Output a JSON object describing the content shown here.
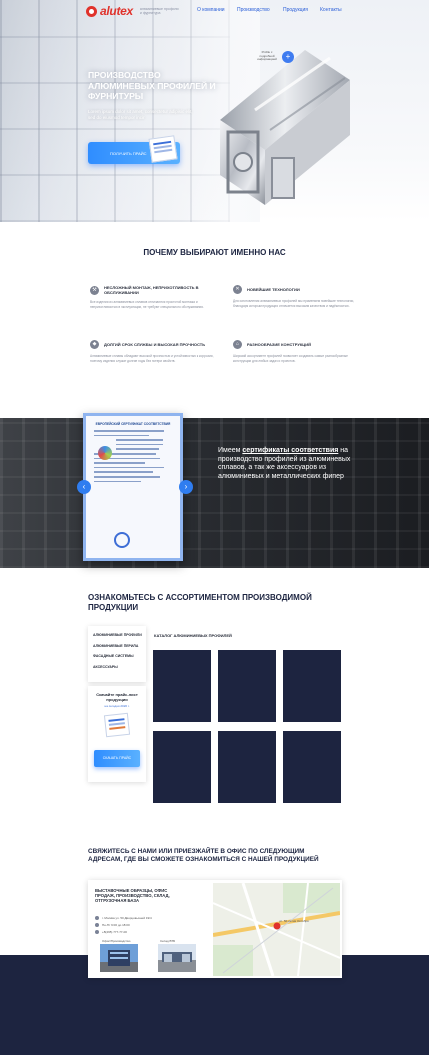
{
  "header": {
    "logo_text": "alutex",
    "logo_tagline": "алюминиевые профили и фурнитура",
    "nav": [
      "О компании",
      "Производство",
      "Продукция",
      "Контакты"
    ]
  },
  "hero": {
    "title": "ПРОИЗВОДСТВО АЛЮМИНЕВЫХ ПРОФИЛЕЙ И ФУРНИТУРЫ",
    "subtitle": "Lorem ipsum dolor sit amet, consectetur adipisic elit, sed do eiusmod tempor incir",
    "cta_label": "ПОЛУЧИТЬ ПРАЙС",
    "pin_label": "Profile с подробной информацией",
    "pin_icon": "plus-icon"
  },
  "why": {
    "title": "ПОЧЕМУ ВЫБИРАЮТ ИМЕННО НАС",
    "features": [
      {
        "icon": "wrench-icon",
        "title": "НЕСЛОЖНЫЙ МОНТАЖ, НЕПРИХОТЛИВОСТЬ В ОБСЛУЖИВАНИИ",
        "text": "Все изделия из алюминиевых сплавов отличаются простотой монтажа и неприхотливостью в эксплуатации, не требуют специального обслуживания."
      },
      {
        "icon": "tech-icon",
        "title": "НОВЕЙШИЕ ТЕХНОЛОГИИ",
        "text": "Для изготовления алюминиевых профилей мы применяем новейшие технологии, благодаря которым продукция отличается высоким качеством и надёжностью."
      },
      {
        "icon": "shield-icon",
        "title": "ДОЛГИЙ СРОК СЛУЖБЫ И ВЫСОКАЯ ПРОЧНОСТЬ",
        "text": "Алюминиевые сплавы обладают высокой прочностью и устойчивостью к коррозии, поэтому изделия служат долгие годы без потери свойств."
      },
      {
        "icon": "house-icon",
        "title": "РАЗНООБРАЗИЕ КОНСТРУКЦИЙ",
        "text": "Широкий ассортимент профилей позволяет создавать самые разнообразные конструкции для любых задач и проектов."
      }
    ]
  },
  "cert": {
    "doc_title": "ЕВРОПЕЙСКИЙ СЕРТИФИКАТ СООТВЕТСТВИЯ",
    "text_prefix": "Имеем",
    "text_highlight": "сертификаты соответствия",
    "text_rest": "на производство профилей из алюминевых сплавов, а так же аксессуаров из алюминиевых и металлических фипер"
  },
  "catalog": {
    "title": "ОЗНАКОМЬТЕСЬ С АССОРТИМЕНТОМ ПРОИЗВОДИМОЙ ПРОДУКЦИИ",
    "menu": [
      "АЛЮМИНИЕВЫЕ ПРОФИЛИ",
      "АЛЮМИНИЕВЫЕ ПЕРИЛА",
      "ФАСАДНЫЕ СИСТЕМЫ",
      "АКСЕССУАРЫ"
    ],
    "price_title": "Скачайте прайс-лист продукции",
    "price_link": "на сегодня 2020 г.",
    "price_button": "СКАЧАТЬ ПРАЙС",
    "section_label": "КАТАЛОГ АЛЮМИНИЕВЫХ ПРОФИЛЕЙ",
    "tile_color": "#1d2440"
  },
  "contact": {
    "title": "СВЯЖИТЕСЬ С НАМИ ИЛИ ПРИЕЗЖАЙТЕ В ОФИС ПО СЛЕДУЮЩИМ АДРЕСАМ, ГДЕ ВЫ СМОЖЕТЕ ОЗНАКОМИТЬСЯ С НАШЕЙ ПРОДУКЦИЕЙ",
    "card_title": "ВЫСТАВОЧНЫЕ ОБРАЗЦЫ, ОФИС ПРОДАЖ, ПРОИЗВОДСТВО, СКЛАД, ОТГРУЗОЧНАЯ БАЗА",
    "address": "г. Москва ул. 50 Дворцовыхней 19/4",
    "hours": "Пн-Пт 9:00 до 18:00",
    "phone": "+8(495) 777-77-00",
    "thumb1_label": "Офис/Производство",
    "thumb2_label": "Склад ВТБ",
    "map_road_label": "ул. 50-летия Октября"
  },
  "colors": {
    "accent": "#2f7df0",
    "navy": "#1d2440",
    "brand_red": "#e0322b"
  }
}
